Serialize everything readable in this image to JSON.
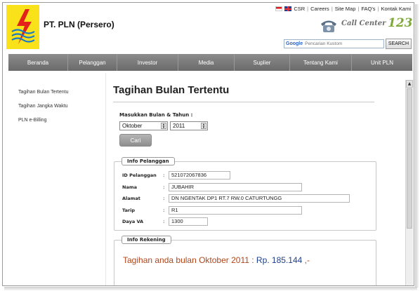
{
  "header": {
    "company_name": "PT. PLN (Persero)",
    "call_center_text": "Call Center",
    "call_center_number": "123"
  },
  "toplinks": {
    "items": [
      "CSR",
      "Careers",
      "Site Map",
      "FAQ's",
      "Kontak Kami"
    ]
  },
  "search": {
    "provider_label": "Google",
    "placeholder": "Pencarian Kustom",
    "button_label": "SEARCH"
  },
  "nav": {
    "items": [
      "Beranda",
      "Pelanggan",
      "Investor",
      "Media",
      "Suplier",
      "Tentang Kami",
      "Unit PLN"
    ]
  },
  "sidebar": {
    "items": [
      "Tagihan Bulan Tertentu",
      "Tagihan Jangka Waktu",
      "PLN e-Billing"
    ]
  },
  "main": {
    "title": "Tagihan Bulan Tertentu",
    "period_label": "Masukkan Bulan & Tahun :",
    "month_value": "Oktober",
    "year_value": "2011",
    "search_button": "Cari"
  },
  "customer_info": {
    "legend": "Info Pelanggan",
    "fields": [
      {
        "label": "ID Pelanggan",
        "value": "521072067836"
      },
      {
        "label": "Nama",
        "value": "JUBAHIR"
      },
      {
        "label": "Alamat",
        "value": "DN NGENTAK DP1  RT.7 RW.0 CATURTUNGG"
      },
      {
        "label": "Tarip",
        "value": "R1"
      },
      {
        "label": "Daya VA",
        "value": "1300"
      }
    ]
  },
  "billing_info": {
    "legend": "Info Rekening",
    "text": "Tagihan anda bulan Oktober 2011 : ",
    "amount": "Rp. 185.144",
    "suffix": " ,-"
  },
  "colors": {
    "logo_yellow": "#f9e21a",
    "nav_gray": "#7a7a7a",
    "bill_text": "#b0461a",
    "bill_amount": "#1c3f8f"
  }
}
